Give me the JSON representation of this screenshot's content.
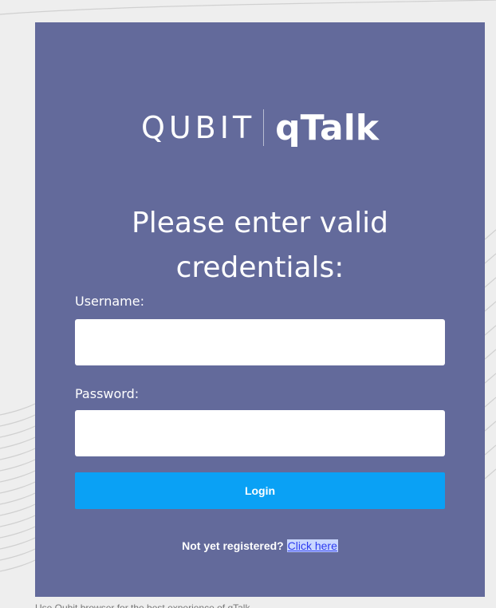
{
  "logo": {
    "brand": "QUBIT",
    "product": "qTalk"
  },
  "heading": {
    "line1": "Please enter valid",
    "line2": "credentials:"
  },
  "form": {
    "username_label": "Username:",
    "username_value": "",
    "password_label": "Password:",
    "password_value": "",
    "login_label": "Login"
  },
  "register": {
    "prompt": "Not yet registered?",
    "link_label": "Click here"
  },
  "footer": {
    "text": "Use Qubit browser for the best experience of qTalk"
  },
  "colors": {
    "card_background": "#636a9b",
    "page_background": "#eeeeee",
    "login_button": "#0aa1f5",
    "link": "#2d3cf0"
  }
}
